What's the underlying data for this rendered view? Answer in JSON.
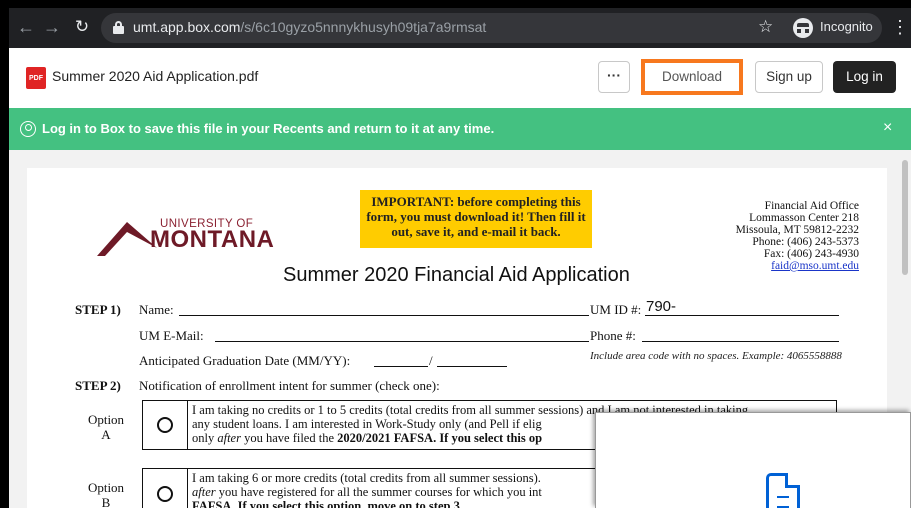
{
  "browser": {
    "url_host": "umt.app.box.com",
    "url_path": "/s/6c10gyzo5nnnykhusyh09tja7a9rmsat",
    "incognito_label": "Incognito"
  },
  "header": {
    "file_name": "Summer 2020 Aid Application.pdf",
    "file_badge": "PDF",
    "more_label": "···",
    "download_label": "Download",
    "signup_label": "Sign up",
    "login_label": "Log in"
  },
  "banner": {
    "text": "Log in to Box to save this file in your Recents and return to it at any time.",
    "close_label": "×"
  },
  "document": {
    "important_lines": [
      "IMPORTANT: before completing this",
      "form, you must download it! Then fill it",
      "out, save it, and e-mail it back."
    ],
    "office_lines": [
      "Financial Aid Office",
      "Lommasson Center 218",
      "Missoula, MT  59812-2232",
      "Phone: (406) 243-5373",
      "Fax: (406) 243-4930"
    ],
    "office_email": "faid@mso.umt.edu",
    "logo_top": "UNIVERSITY OF",
    "logo_main": "MONTANA",
    "title": "Summer 2020 Financial Aid Application",
    "step1_label": "STEP 1)",
    "name_label": "Name:",
    "umid_label": "UM ID #:",
    "umid_value": "790-",
    "email_label": "UM E-Mail:",
    "phone_label": "Phone #:",
    "phone_hint": "Include area code with no spaces. Example: 4065558888",
    "grad_label": "Anticipated Graduation Date (MM/YY):",
    "grad_sep": "/",
    "step2_label": "STEP 2)",
    "step2_text": "Notification of enrollment intent for summer (check one):",
    "option_a_label": "Option",
    "option_a_letter": "A",
    "option_a_line1": "I am taking no credits or 1 to 5 credits (total credits from all summer sessions) and I am not interested in taking",
    "option_a_line2": "any student loans. I am interested in Work-Study only (and Pell if elig",
    "option_a_line3_pre": "only ",
    "option_a_line3_em": "after",
    "option_a_line3_mid": " you have filed the ",
    "option_a_line3_bold": "2020/2021 FAFSA. If you select this op",
    "option_b_label": "Option",
    "option_b_letter": "B",
    "option_b_line1": "I am taking 6 or more credits (total credits from all summer sessions).",
    "option_b_line2_em": "after",
    "option_b_line2_rest": " you have registered for all the summer courses for which you int",
    "option_b_line3": "FAFSA. If you select this option, move on to step 3."
  },
  "colors": {
    "banner": "#44c181",
    "download_highlight": "#f7781e",
    "important_bg": "#ffcc00",
    "montana_maroon": "#6e1a27",
    "box_blue": "#0061d5"
  },
  "icons": [
    "back-arrow-icon",
    "forward-arrow-icon",
    "reload-icon",
    "lock-icon",
    "star-icon",
    "incognito-icon",
    "kebab-menu-icon",
    "pdf-file-icon",
    "user-circle-icon",
    "close-icon",
    "document-icon"
  ]
}
